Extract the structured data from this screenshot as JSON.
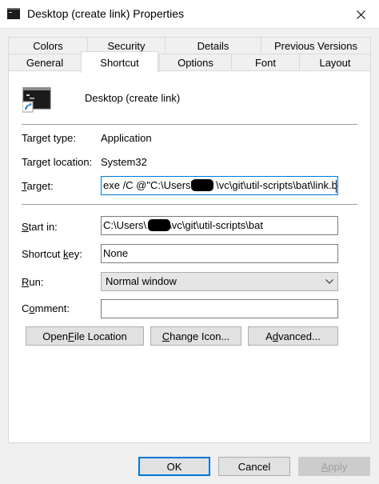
{
  "window": {
    "title": "Desktop (create link) Properties"
  },
  "tabs": {
    "back_row": [
      "Colors",
      "Security",
      "Details",
      "Previous Versions"
    ],
    "front_row": [
      "General",
      "Shortcut",
      "Options",
      "Font",
      "Layout"
    ],
    "active": "Shortcut"
  },
  "shortcut": {
    "name": "Desktop (create link)",
    "target_type_label": "Target type:",
    "target_type": "Application",
    "target_location_label": "Target location:",
    "target_location": "System32",
    "target_label": {
      "accel": "T",
      "rest": "arget:"
    },
    "target_value": {
      "before": "exe /C @\"C:\\Users\\",
      "after": "\\vc\\git\\util-scripts\\bat\\link.bat\""
    },
    "start_in_label": {
      "accel": "S",
      "rest": "tart in:"
    },
    "start_in_value": {
      "before": "C:\\Users\\",
      "after": "\\vc\\git\\util-scripts\\bat"
    },
    "shortcut_key_label": {
      "pre": "Shortcut ",
      "accel": "k",
      "post": "ey:"
    },
    "shortcut_key_value": "None",
    "run_label": {
      "accel": "R",
      "rest": "un:"
    },
    "run_value": "Normal window",
    "comment_label": {
      "pre": "C",
      "accel": "o",
      "post": "mment:"
    },
    "comment_value": ""
  },
  "buttons": {
    "open_file_location": {
      "pre": "Open ",
      "accel": "F",
      "post": "ile Location"
    },
    "change_icon": {
      "pre": "",
      "accel": "C",
      "post": "hange Icon..."
    },
    "advanced": {
      "pre": "A",
      "accel": "d",
      "post": "vanced..."
    },
    "ok": "OK",
    "cancel": "Cancel",
    "apply": {
      "pre": "",
      "accel": "A",
      "post": "pply"
    }
  },
  "icons": {
    "title": "console-window-icon",
    "app": "console-shortcut-icon",
    "close": "close-icon",
    "dropdown": "chevron-down-icon"
  },
  "colors": {
    "accent": "#0078d7",
    "window_bg": "#f0f0f0",
    "button_bg": "#e1e1e1",
    "disabled_text": "#a0a0a0"
  }
}
